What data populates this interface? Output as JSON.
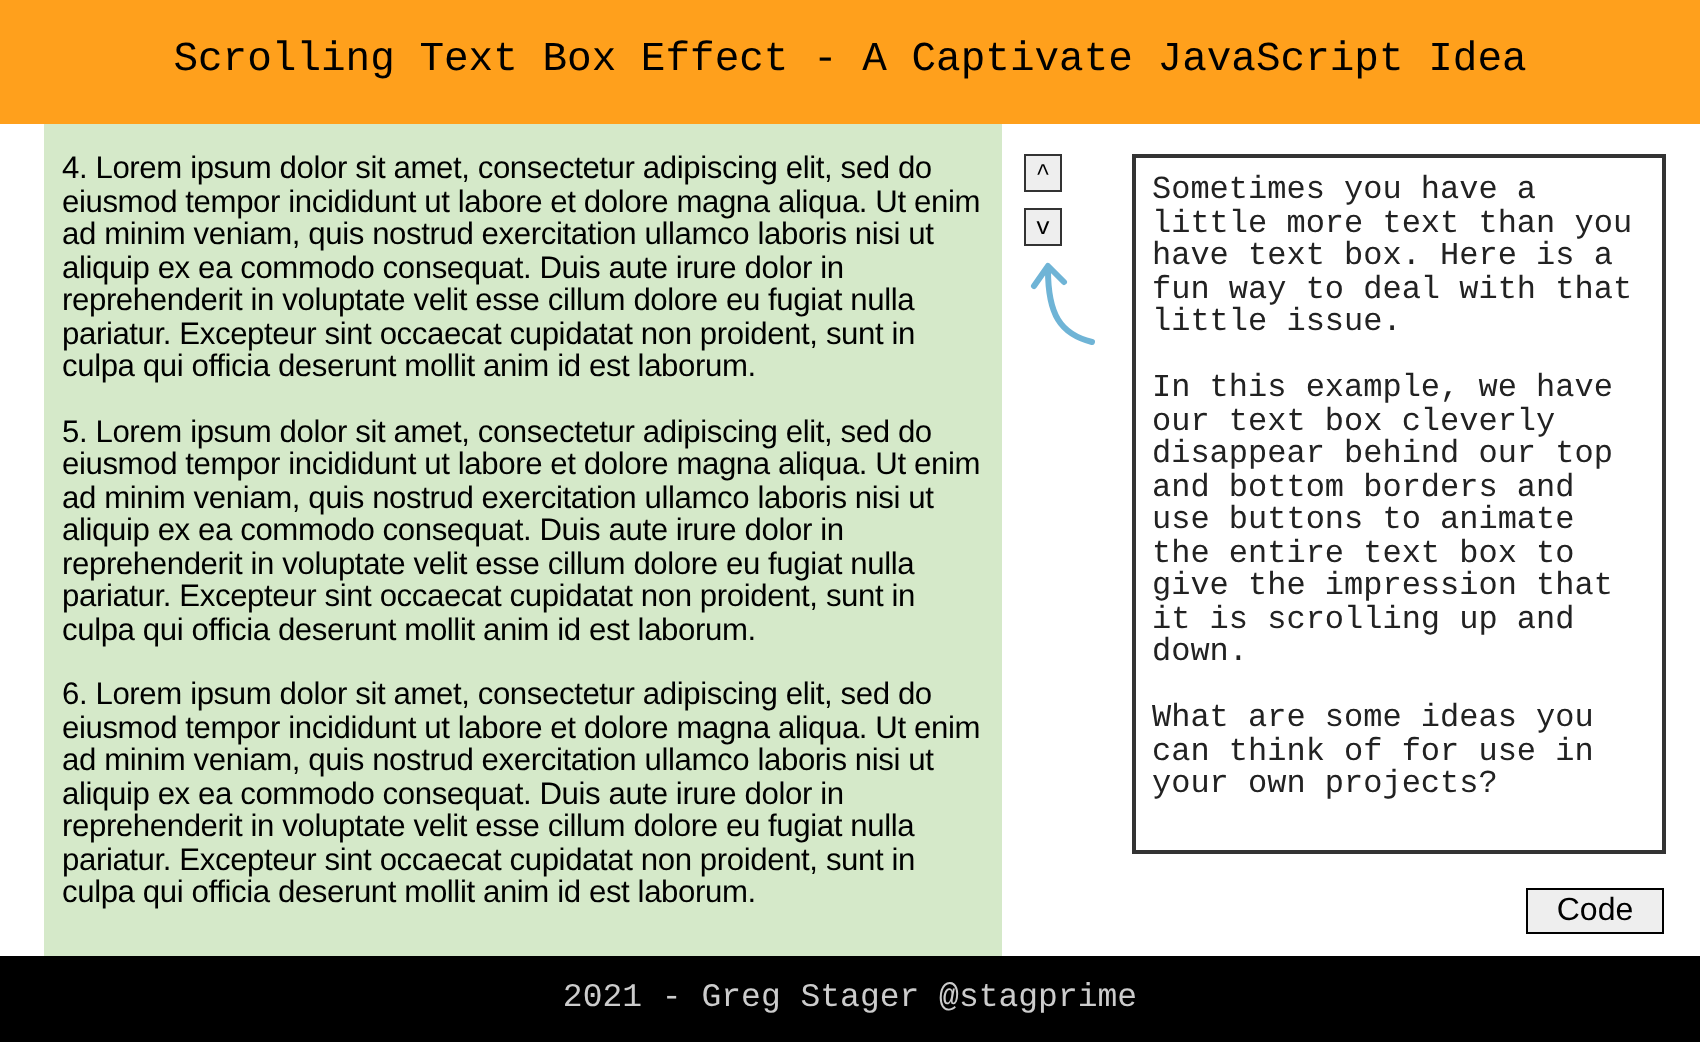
{
  "header": {
    "title": "Scrolling Text Box Effect - A Captivate JavaScript Idea"
  },
  "scroll_panel": {
    "paragraphs": [
      "4. Lorem ipsum dolor sit amet, consectetur adipiscing elit, sed do eiusmod tempor incididunt ut labore et dolore magna aliqua. Ut enim ad minim veniam, quis nostrud exercitation ullamco laboris nisi ut aliquip ex ea commodo consequat. Duis aute irure dolor in reprehenderit in voluptate velit esse cillum dolore eu fugiat nulla pariatur. Excepteur sint occaecat cupidatat non proident, sunt in culpa qui officia deserunt mollit anim id est laborum.",
      "5. Lorem ipsum dolor sit amet, consectetur adipiscing elit, sed do eiusmod tempor incididunt ut labore et dolore magna aliqua. Ut enim ad minim veniam, quis nostrud exercitation ullamco laboris nisi ut aliquip ex ea commodo consequat. Duis aute irure dolor in reprehenderit in voluptate velit esse cillum dolore eu fugiat nulla pariatur. Excepteur sint occaecat cupidatat non proident, sunt in culpa qui officia deserunt mollit anim id est laborum.",
      "6. Lorem ipsum dolor sit amet, consectetur adipiscing elit, sed do eiusmod tempor incididunt ut labore et dolore magna aliqua. Ut enim ad minim veniam, quis nostrud exercitation ullamco laboris nisi ut aliquip ex ea commodo consequat. Duis aute irure dolor in reprehenderit in voluptate velit esse cillum dolore eu fugiat nulla pariatur. Excepteur sint occaecat cupidatat non proident, sunt in culpa qui officia deserunt mollit anim id est laborum."
    ]
  },
  "scroll_buttons": [
    {
      "label": "^"
    },
    {
      "label": "v"
    }
  ],
  "info_box": {
    "paragraphs": [
      "Sometimes you have a little more text than you have text box. Here is a fun way to deal with that little issue.",
      "In this example, we have our text box cleverly disappear behind our top and bottom borders and use buttons to animate the entire text box to give the impression that it is scrolling up and down.",
      "What are some ideas you can think of for use in your own projects?"
    ]
  },
  "code_button": {
    "label": "Code"
  },
  "footer": {
    "text": "2021 - Greg Stager @stagprime"
  }
}
